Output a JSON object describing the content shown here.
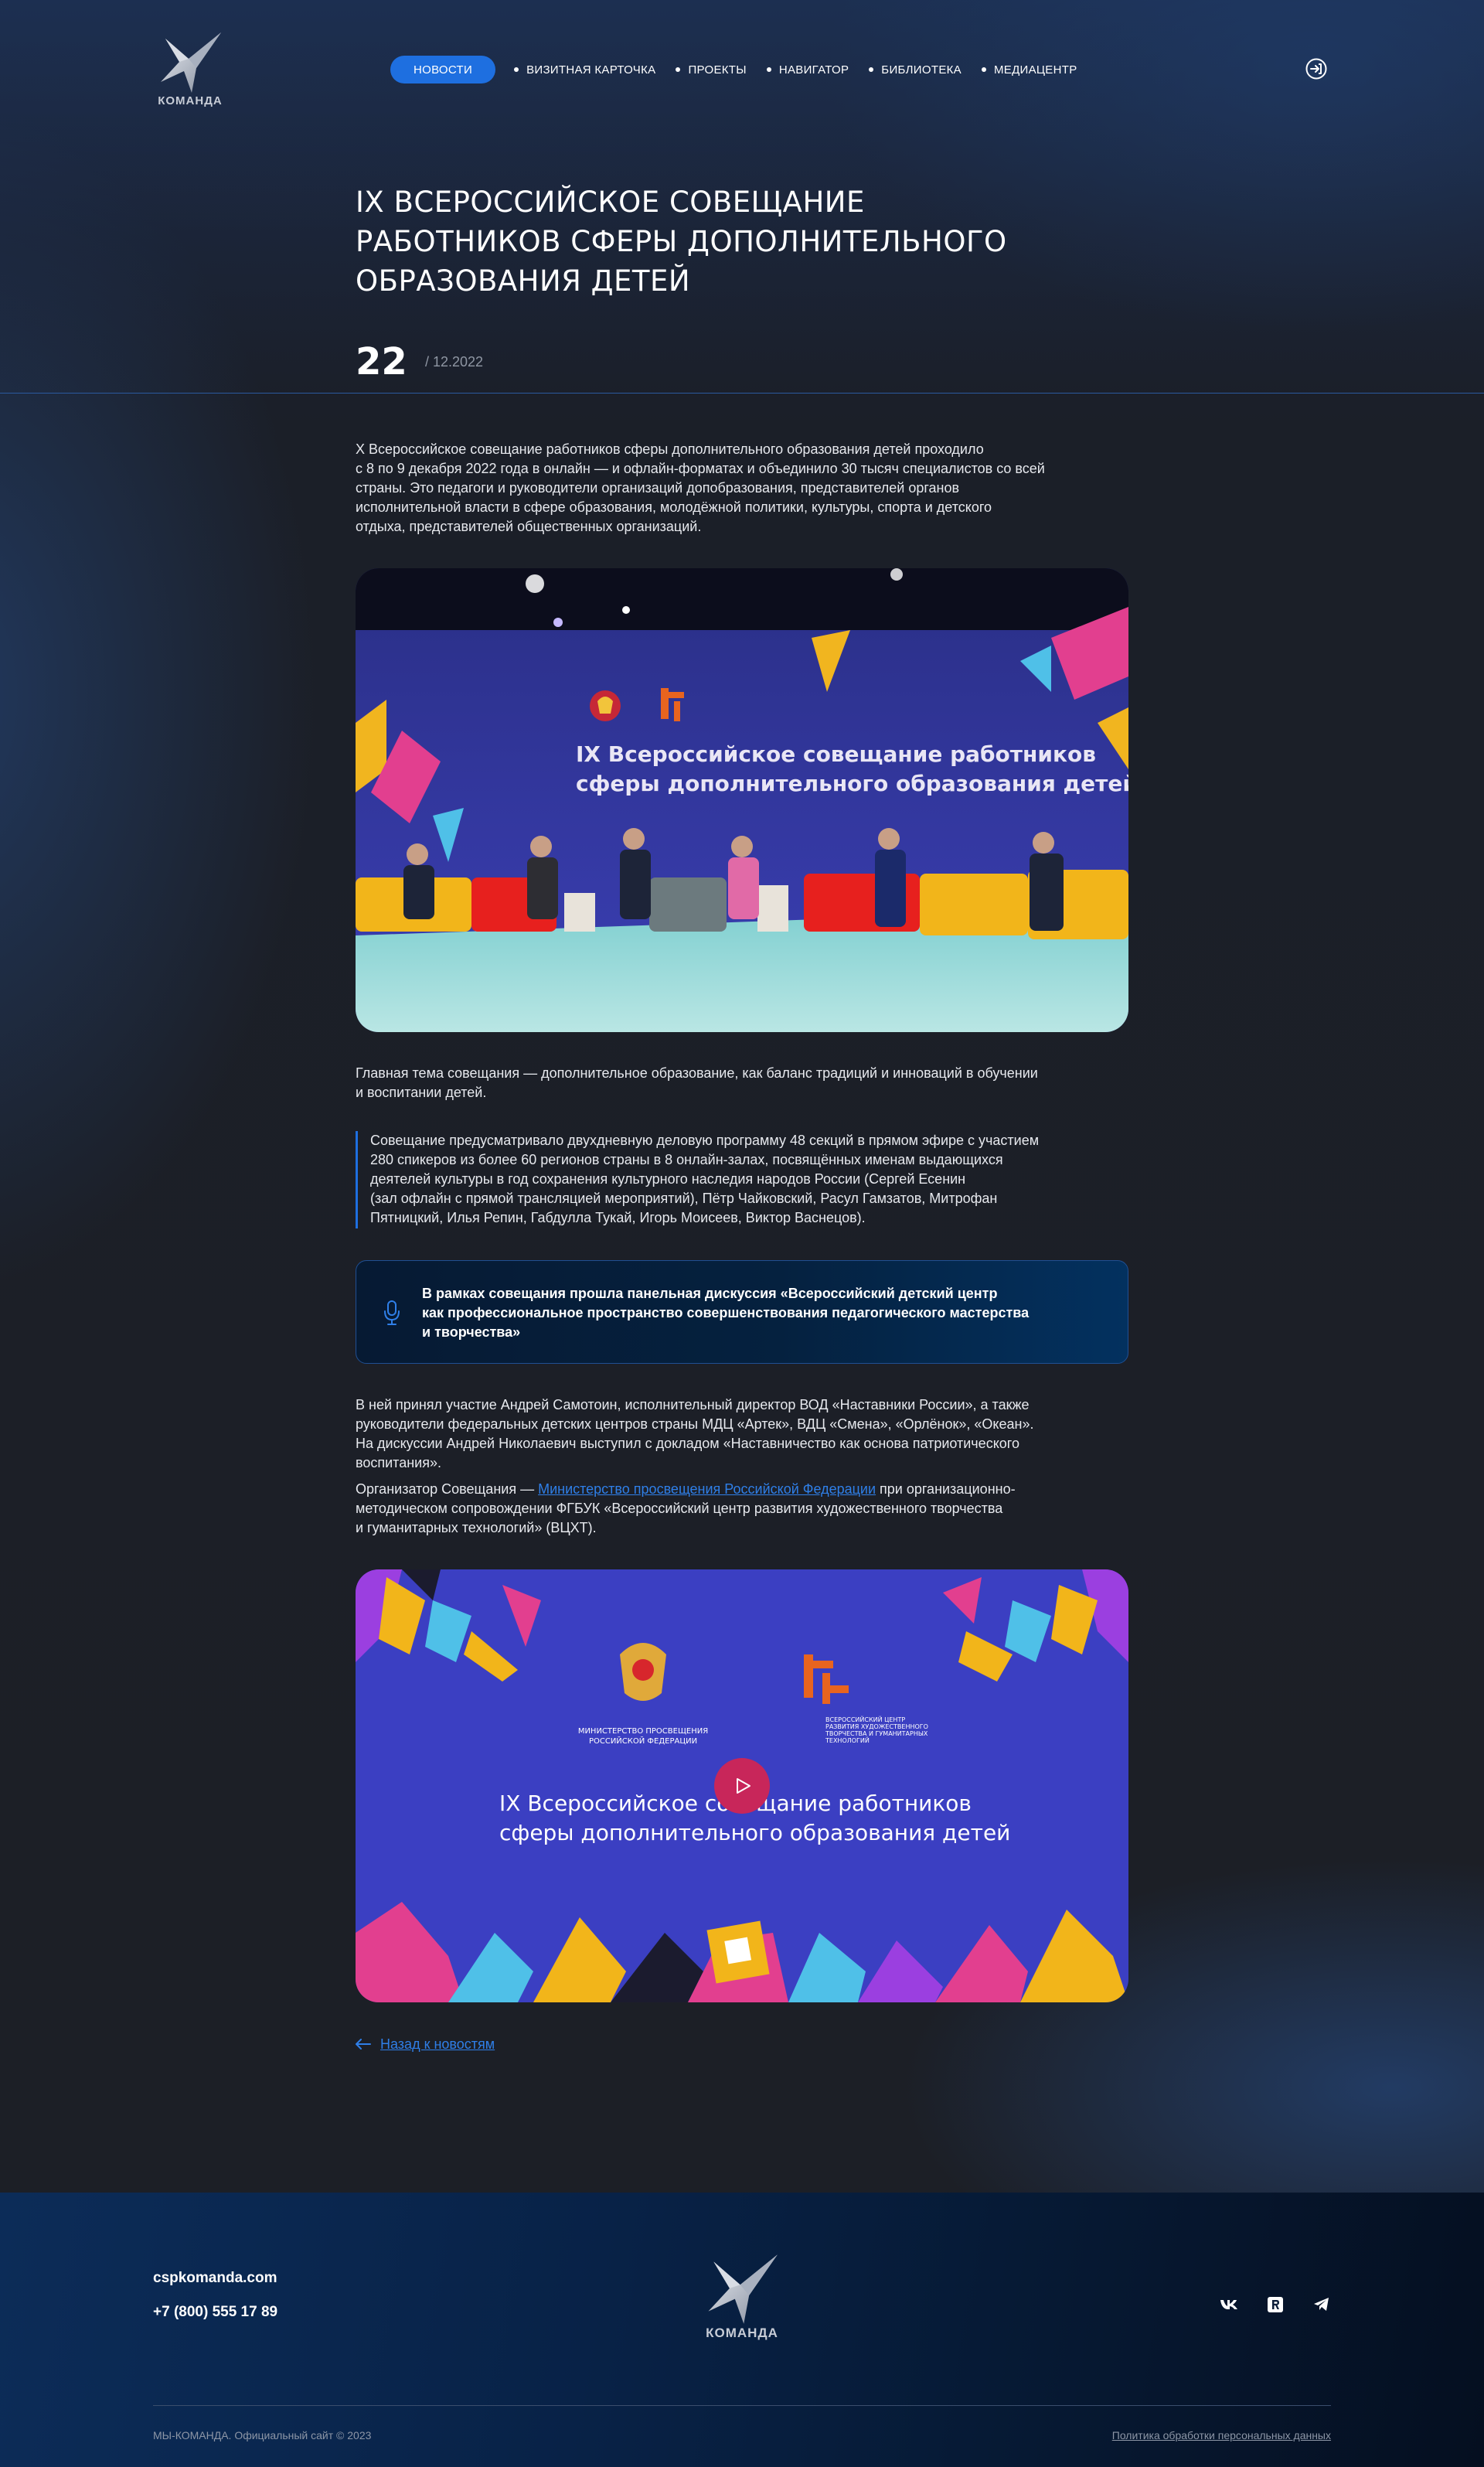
{
  "header": {
    "logo_text": "КОМАНДА",
    "nav": [
      {
        "label": "НОВОСТИ",
        "active": true
      },
      {
        "label": "ВИЗИТНАЯ КАРТОЧКА"
      },
      {
        "label": "ПРОЕКТЫ"
      },
      {
        "label": "НАВИГАТОР"
      },
      {
        "label": "БИБЛИОТЕКА"
      },
      {
        "label": "МЕДИАЦЕНТР"
      }
    ],
    "login_icon": "login-icon"
  },
  "article": {
    "title_lines": [
      "IX ВСЕРОССИЙСКОЕ СОВЕЩАНИЕ",
      "РАБОТНИКОВ СФЕРЫ ДОПОЛНИТЕЛЬНОГО",
      "ОБРАЗОВАНИЯ ДЕТЕЙ"
    ],
    "date_day": "22",
    "date_rest": "/ 12.2022",
    "intro": [
      "X Всероссийское совещание работников сферы дополнительного образования детей проходило",
      "с 8 по 9 декабря 2022 года в онлайн — и офлайн-форматах и объединило 30 тысяч специалистов со всей",
      "страны. Это педагоги и руководители организаций допобразования, представителей органов",
      "исполнительной власти в сфере образования, молодёжной политики, культуры, спорта и детского",
      "отдыха, представителей общественных организаций."
    ],
    "photo": {
      "banner_line1": "IX Всероссийское совещание работников",
      "banner_line2": "сферы дополнительного образования детей"
    },
    "theme": [
      "Главная тема совещания — дополнительное образование, как баланс традиций и инноваций в обучении",
      "и воспитании детей."
    ],
    "quote": [
      "Совещание предусматривало двухдневную деловую программу 48 секций в прямом эфире с участием",
      "280 спикеров из более 60 регионов страны в 8 онлайн-залах, посвящённых именам выдающихся",
      "деятелей культуры в год сохранения культурного наследия народов России (Сергей Есенин",
      "(зал офлайн с прямой трансляцией мероприятий), Пётр Чайковский, Расул Гамзатов, Митрофан",
      "Пятницкий, Илья Репин, Габдулла Тукай, Игорь Моисеев, Виктор Васнецов)."
    ],
    "callout": [
      "В рамках совещания прошла панельная дискуссия «Всероссийский детский центр",
      "как профессиональное пространство совершенствования педагогического мастерства",
      "и творчества»"
    ],
    "samotoin": [
      "В ней принял участие Андрей Самотоин, исполнительный директор ВОД «Наставники России», а также",
      "руководители федеральных детских центров страны МДЦ «Артек», ВДЦ «Смена», «Орлёнок», «Океан».",
      "На дискуссии Андрей Николаевич выступил с докладом «Наставничество как основа патриотического",
      "воспитания»."
    ],
    "organizer": {
      "prefix": "Организатор Совещания — ",
      "link": "Министерство просвещения Российской Федерации",
      "suffix": " при организационно-",
      "line2": "методическом сопровождении ФГБУК «Всероссийский центр развития художественного творчества",
      "line3": "и гуманитарных технологий» (ВЦХТ)."
    },
    "video": {
      "ministry_line1": "МИНИСТЕРСТВО ПРОСВЕЩЕНИЯ",
      "ministry_line2": "РОССИЙСКОЙ ФЕДЕРАЦИИ",
      "vtsht_lines": [
        "ВСЕРОССИЙСКИЙ ЦЕНТР",
        "РАЗВИТИЯ ХУДОЖЕСТВЕННОГО",
        "ТВОРЧЕСТВА И ГУМАНИТАРНЫХ",
        "ТЕХНОЛОГИЙ"
      ],
      "title_line1": "IX Всероссийское совещание работников",
      "title_line2": "сферы дополнительного образования детей",
      "play_icon": "play-icon"
    },
    "back_label": "Назад к новостям"
  },
  "footer": {
    "site": "cspkomanda.com",
    "phone": "+7 (800) 555 17 89",
    "logo_text": "КОМАНДА",
    "socials": [
      "vk-icon",
      "rutube-icon",
      "telegram-icon"
    ],
    "copyright": "МЫ-КОМАНДА. Официальный сайт © 2023",
    "policy": "Политика обработки персональных данных"
  },
  "colors": {
    "accent": "#1e6fe0",
    "link": "#2f7fe8",
    "background": "#1b1e25",
    "play_button": "#c8265a"
  }
}
